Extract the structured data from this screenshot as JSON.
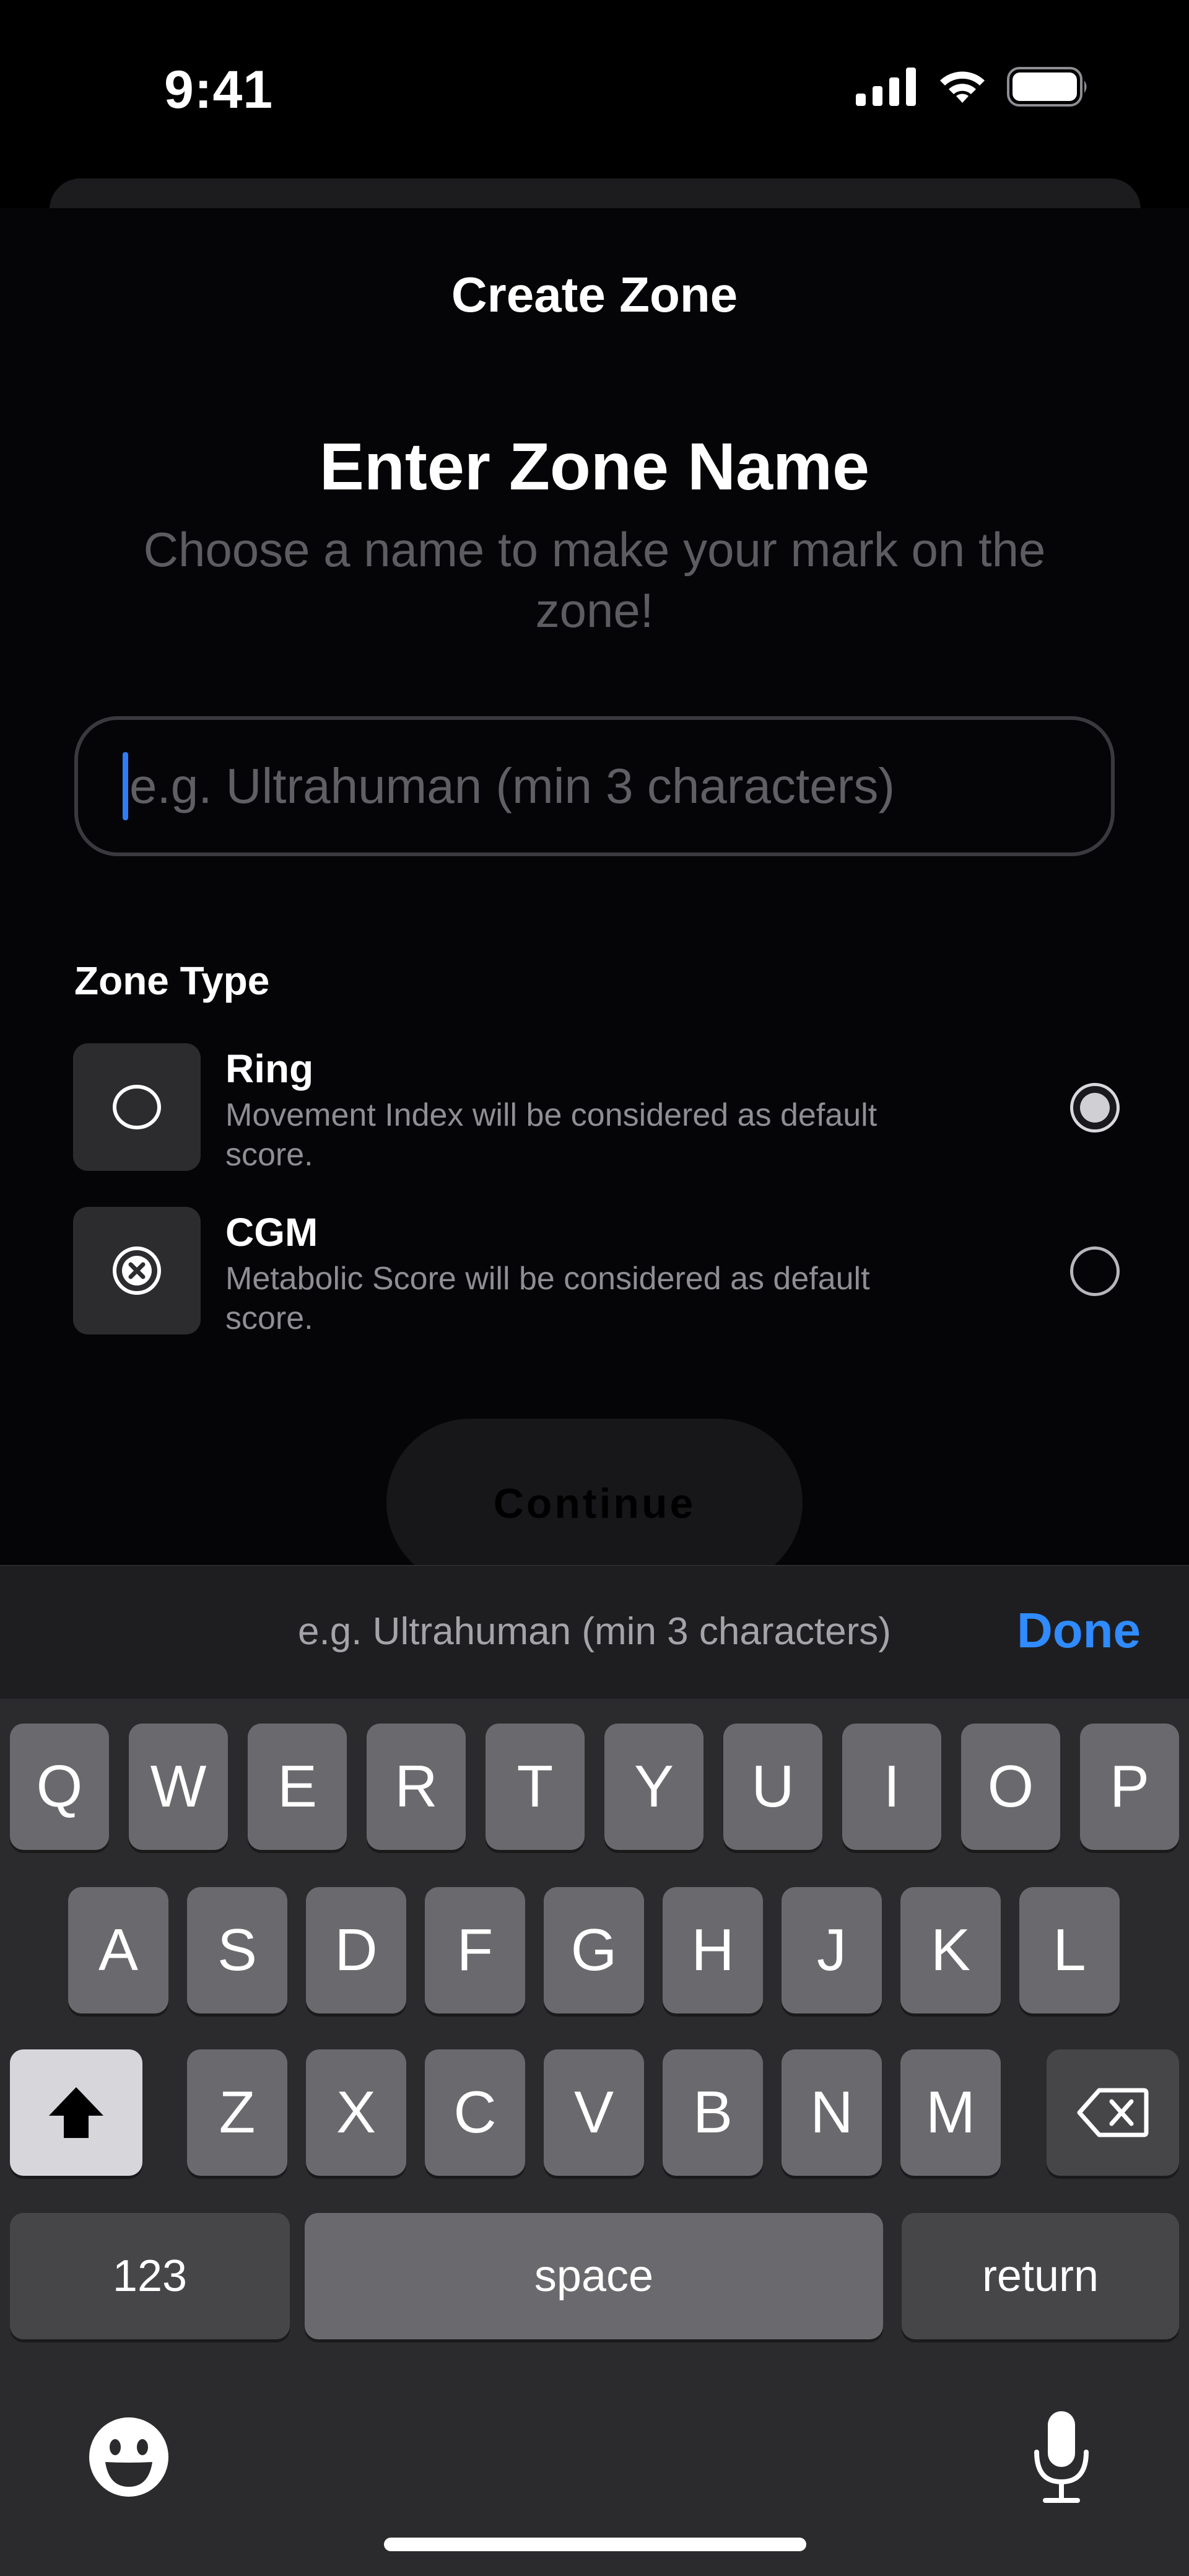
{
  "status_bar": {
    "time": "9:41"
  },
  "sheet": {
    "title": "Create Zone",
    "heading": "Enter Zone Name",
    "subheading": "Choose a name to make your mark on the zone!"
  },
  "name_field": {
    "value": "",
    "placeholder": "e.g. Ultrahuman (min 3 characters)"
  },
  "zone_type": {
    "label": "Zone Type",
    "options": [
      {
        "title": "Ring",
        "description": "Movement Index will be considered as default score.",
        "selected": true,
        "icon": "ring-icon"
      },
      {
        "title": "CGM",
        "description": "Metabolic Score will be considered as default score.",
        "selected": false,
        "icon": "cgm-icon"
      }
    ]
  },
  "continue_label": "Continue",
  "keyboard": {
    "accessory_hint": "e.g. Ultrahuman (min 3 characters)",
    "done_label": "Done",
    "row1": [
      "Q",
      "W",
      "E",
      "R",
      "T",
      "Y",
      "U",
      "I",
      "O",
      "P"
    ],
    "row2": [
      "A",
      "S",
      "D",
      "F",
      "G",
      "H",
      "J",
      "K",
      "L"
    ],
    "row3": [
      "Z",
      "X",
      "C",
      "V",
      "B",
      "N",
      "M"
    ],
    "numbers_label": "123",
    "space_label": "space",
    "return_label": "return"
  },
  "colors": {
    "accent": "#2F8BFF",
    "caret": "#2F7CF6",
    "background": "#000000"
  }
}
